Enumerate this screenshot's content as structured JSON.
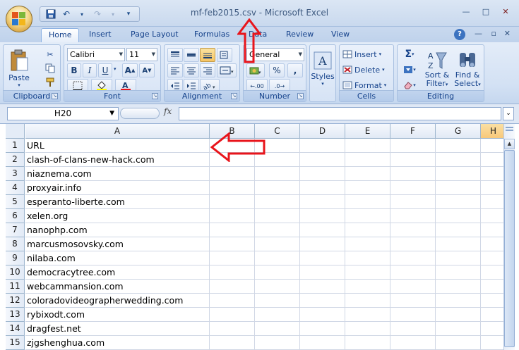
{
  "window": {
    "title": "mf-feb2015.csv - Microsoft Excel",
    "minimize": "—",
    "maximize": "□",
    "close": "✕"
  },
  "qat": {
    "save": "💾",
    "undo": "↶",
    "redo": "↷",
    "customize": "▾"
  },
  "tabs": [
    {
      "label": "Home",
      "active": true
    },
    {
      "label": "Insert"
    },
    {
      "label": "Page Layout"
    },
    {
      "label": "Formulas"
    },
    {
      "label": "Data"
    },
    {
      "label": "Review"
    },
    {
      "label": "View"
    }
  ],
  "help": "?",
  "ribbon": {
    "clipboard": {
      "label": "Clipboard",
      "paste": "Paste"
    },
    "font": {
      "label": "Font",
      "family": "Calibri",
      "size": "11",
      "bold": "B",
      "italic": "I",
      "underline": "U",
      "grow": "A",
      "shrink": "A"
    },
    "alignment": {
      "label": "Alignment"
    },
    "number": {
      "label": "Number",
      "format": "General",
      "percent": "%",
      "comma": ",",
      "increase": ".00",
      "decrease": ".0"
    },
    "styles": {
      "label": "Styles"
    },
    "cells": {
      "label": "Cells",
      "insert": "Insert",
      "delete": "Delete",
      "format": "Format"
    },
    "editing": {
      "label": "Editing",
      "sum": "Σ",
      "sort": "Sort &",
      "sort2": "Filter",
      "find": "Find &",
      "find2": "Select"
    }
  },
  "formula": {
    "name_box": "H20",
    "fx": "fx",
    "value": ""
  },
  "grid": {
    "columns": [
      "A",
      "B",
      "C",
      "D",
      "E",
      "F",
      "G",
      "H"
    ],
    "rows": [
      {
        "n": "1",
        "a": "URL"
      },
      {
        "n": "2",
        "a": "clash-of-clans-new-hack.com"
      },
      {
        "n": "3",
        "a": "niaznema.com"
      },
      {
        "n": "4",
        "a": "proxyair.info"
      },
      {
        "n": "5",
        "a": "esperanto-liberte.com"
      },
      {
        "n": "6",
        "a": "xelen.org"
      },
      {
        "n": "7",
        "a": "nanophp.com"
      },
      {
        "n": "8",
        "a": "marcusmosovsky.com"
      },
      {
        "n": "9",
        "a": "nilaba.com"
      },
      {
        "n": "10",
        "a": "democracytree.com"
      },
      {
        "n": "11",
        "a": "webcammansion.com"
      },
      {
        "n": "12",
        "a": "coloradovideographerwedding.com"
      },
      {
        "n": "13",
        "a": "rybixodt.com"
      },
      {
        "n": "14",
        "a": "dragfest.net"
      },
      {
        "n": "15",
        "a": "zjgshenghua.com"
      }
    ]
  },
  "colors": {
    "ribbon_text": "#15428b",
    "annotation_arrow": "#e8141b",
    "selected_column": "#f8c87a"
  }
}
